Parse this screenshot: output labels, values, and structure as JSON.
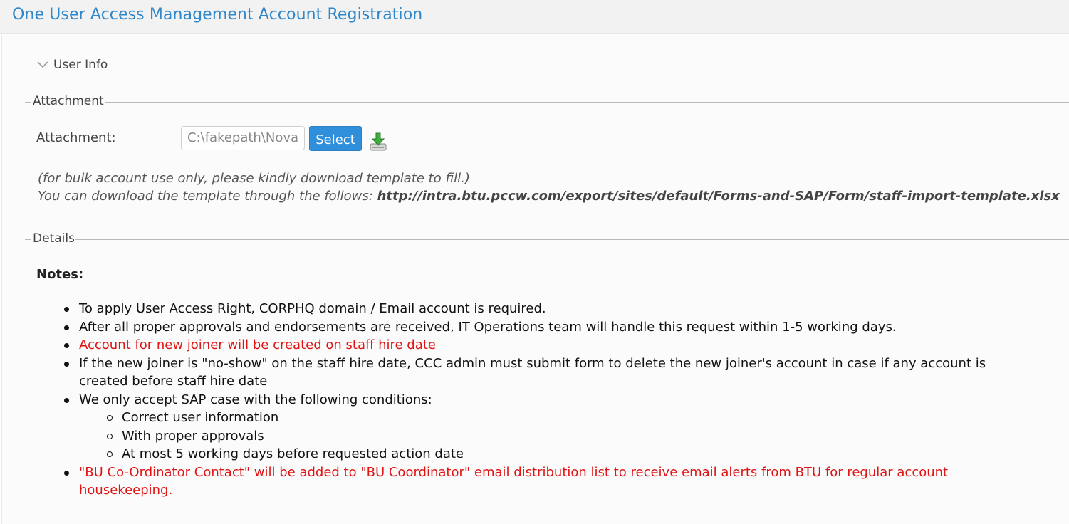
{
  "header": {
    "title": "One User Access Management Account Registration"
  },
  "sections": {
    "user_info": {
      "legend": "User Info",
      "collapsed": true
    },
    "attachment": {
      "legend": "Attachment",
      "field_label": "Attachment:",
      "file_value": "C:\\fakepath\\Nova",
      "select_label": "Select",
      "help_line1": "(for bulk account use only, please kindly download template to fill.)",
      "help_line2": "You can download the template through the follows: ",
      "template_link": "http://intra.btu.pccw.com/export/sites/default/Forms-and-SAP/Form/staff-import-template.xlsx"
    },
    "details": {
      "legend": "Details",
      "notes_title": "Notes:",
      "notes": [
        "To apply User Access Right, CORPHQ domain / Email account is required.",
        "After all proper approvals and endorsements are received, IT Operations team will handle this request within 1-5 working days.",
        "Account for new joiner will be created on staff hire date",
        "If the new joiner is \"no-show\" on the staff hire date, CCC admin must submit form to delete the new joiner's account in case if any account is created before staff hire date",
        "We only accept SAP case with the following conditions:",
        "\"BU Co-Ordinator Contact\" will be added to \"BU Coordinator\" email distribution list to receive email alerts from BTU for regular account housekeeping."
      ],
      "sub_conditions": [
        "Correct user information",
        "With proper approvals",
        "At most 5 working days before requested action date"
      ]
    }
  },
  "colors": {
    "title_blue": "#2f86c8",
    "button_blue": "#2f8fdb",
    "alert_red": "#e01414"
  },
  "icons": {
    "collapse": "chevron-down-icon",
    "download": "download-icon"
  }
}
